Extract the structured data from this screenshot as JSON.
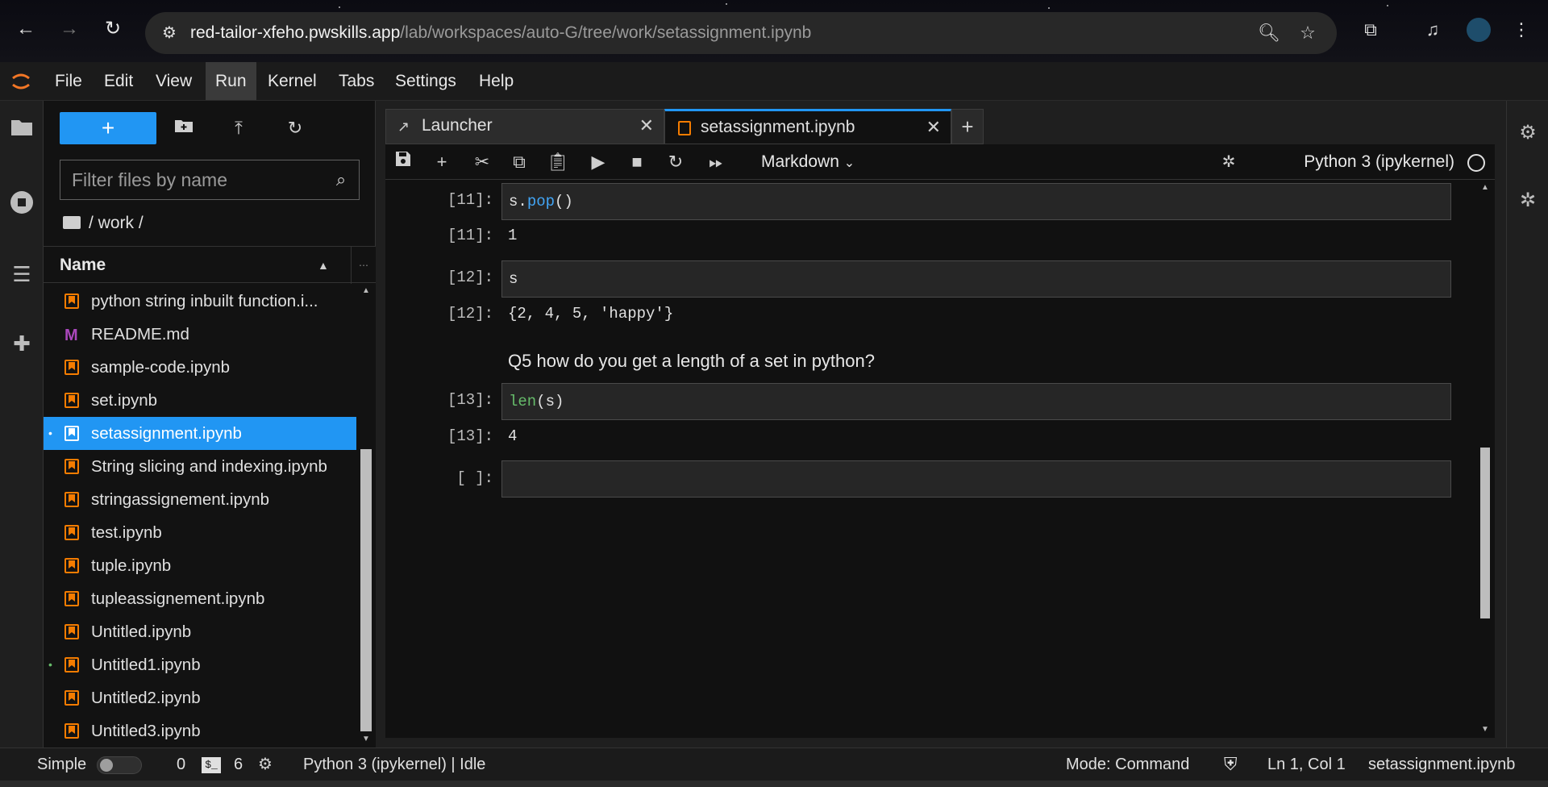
{
  "browser": {
    "url_host": "red-tailor-xfeho.pwskills.app",
    "url_path": "/lab/workspaces/auto-G/tree/work/setassignment.ipynb",
    "icons": [
      "back-arrow",
      "forward-arrow",
      "reload",
      "site-info",
      "zoom",
      "bookmark-star",
      "extensions",
      "media-control",
      "profile-avatar",
      "kebab-menu"
    ]
  },
  "menubar": {
    "items": [
      "File",
      "Edit",
      "View",
      "Run",
      "Kernel",
      "Tabs",
      "Settings",
      "Help"
    ],
    "active": "Run"
  },
  "filebrowser": {
    "new_label": "+",
    "filter_placeholder": "Filter files by name",
    "breadcrumb": "/ work /",
    "header": "Name",
    "files": [
      {
        "name": "python string inbuilt function.i...",
        "type": "notebook",
        "dot": ""
      },
      {
        "name": "README.md",
        "type": "markdown",
        "dot": ""
      },
      {
        "name": "sample-code.ipynb",
        "type": "notebook",
        "dot": ""
      },
      {
        "name": "set.ipynb",
        "type": "notebook",
        "dot": ""
      },
      {
        "name": "setassignment.ipynb",
        "type": "notebook",
        "dot": "•",
        "selected": true
      },
      {
        "name": "String slicing and indexing.ipynb",
        "type": "notebook",
        "dot": ""
      },
      {
        "name": "stringassignement.ipynb",
        "type": "notebook",
        "dot": ""
      },
      {
        "name": "test.ipynb",
        "type": "notebook",
        "dot": ""
      },
      {
        "name": "tuple.ipynb",
        "type": "notebook",
        "dot": ""
      },
      {
        "name": "tupleassignement.ipynb",
        "type": "notebook",
        "dot": ""
      },
      {
        "name": "Untitled.ipynb",
        "type": "notebook",
        "dot": ""
      },
      {
        "name": "Untitled1.ipynb",
        "type": "notebook",
        "dot": "•"
      },
      {
        "name": "Untitled2.ipynb",
        "type": "notebook",
        "dot": ""
      },
      {
        "name": "Untitled3.ipynb",
        "type": "notebook",
        "dot": ""
      }
    ]
  },
  "tabs": [
    {
      "label": "Launcher",
      "close": "✕"
    },
    {
      "label": "setassignment.ipynb",
      "close": "✕",
      "active": true
    }
  ],
  "tab_add": "+",
  "toolbar": {
    "cell_type": "Markdown",
    "kernel": "Python 3 (ipykernel)"
  },
  "cells": {
    "c11_in_prompt": "[11]:",
    "c11_code_obj": "s.",
    "c11_code_fn": "pop",
    "c11_code_rest": "()",
    "c11_out_prompt": "[11]:",
    "c11_out": "1",
    "c12_in_prompt": "[12]:",
    "c12_code": "s",
    "c12_out_prompt": "[12]:",
    "c12_out": "{2, 4, 5, 'happy'}",
    "md_q5": "Q5 how do you get a length of a set in python?",
    "c13_in_prompt": "[13]:",
    "c13_code_fn": "len",
    "c13_code_rest": "(s)",
    "c13_out_prompt": "[13]:",
    "c13_out": "4",
    "empty_prompt": "[ ]:"
  },
  "statusbar": {
    "simple_label": "Simple",
    "simple_on": false,
    "count_a": "0",
    "terminal_glyph": "$_",
    "count_b": "6",
    "kernel_status": "Python 3 (ipykernel) | Idle",
    "mode": "Mode: Command",
    "cursor": "Ln 1, Col 1",
    "filename": "setassignment.ipynb"
  },
  "colors": {
    "accent": "#2196f3",
    "notebook_icon": "#f57c00",
    "markdown_icon": "#aa47bc",
    "function_token": "#42a5f5",
    "builtin_token": "#66bb6a"
  }
}
